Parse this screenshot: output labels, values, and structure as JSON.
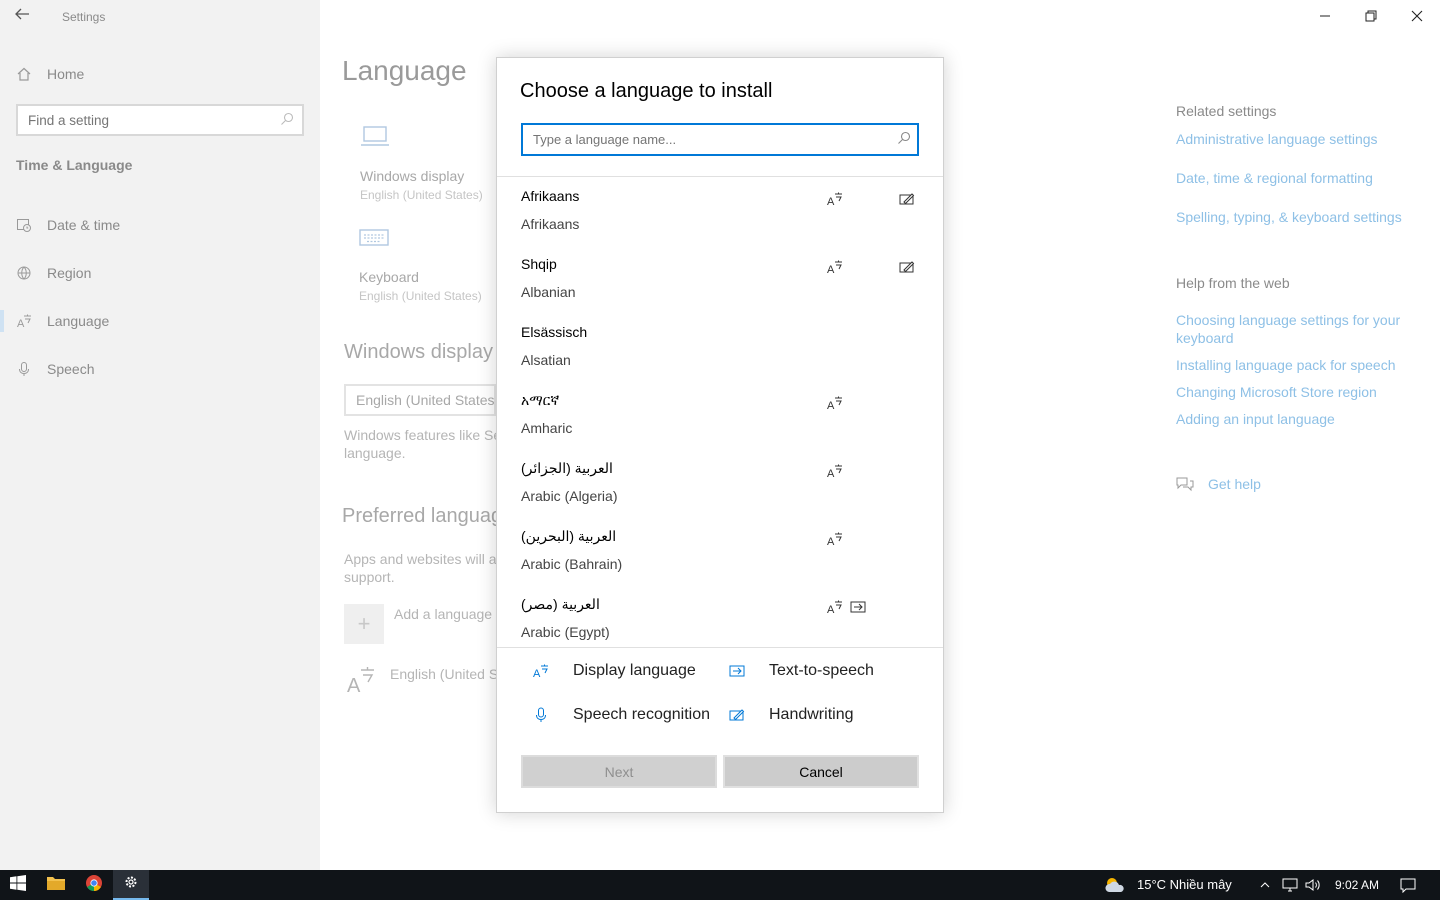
{
  "app": {
    "title": "Settings"
  },
  "sidebar": {
    "home_label": "Home",
    "search_placeholder": "Find a setting",
    "section": "Time & Language",
    "items": [
      {
        "label": "Date & time",
        "icon": "calendar-clock-icon"
      },
      {
        "label": "Region",
        "icon": "globe-icon"
      },
      {
        "label": "Language",
        "icon": "language-icon",
        "selected": true
      },
      {
        "label": "Speech",
        "icon": "microphone-icon"
      }
    ]
  },
  "main": {
    "title": "Language",
    "tiles": [
      {
        "label": "Windows display",
        "sub": "English (United States)",
        "icon": "laptop-icon"
      },
      {
        "label": "Keyboard",
        "sub": "English (United States)",
        "icon": "keyboard-icon"
      }
    ],
    "windows_display_heading": "Windows display",
    "display_dropdown_value": "English (United States)",
    "display_desc_line1": "Windows features like Se",
    "display_desc_line2": "language.",
    "preferred_heading": "Preferred languag",
    "preferred_desc_line1": "Apps and websites will ap",
    "preferred_desc_line2": "support.",
    "add_language_label": "Add a language",
    "english_row_label": "English (United St"
  },
  "related": {
    "heading": "Related settings",
    "links": [
      "Administrative language settings",
      "Date, time & regional formatting",
      "Spelling, typing, & keyboard settings"
    ]
  },
  "help": {
    "heading": "Help from the web",
    "links": [
      "Choosing language settings for your keyboard",
      "Installing language pack for speech",
      "Changing Microsoft Store region",
      "Adding an input language"
    ],
    "get_help": "Get help"
  },
  "dialog": {
    "title": "Choose a language to install",
    "search_placeholder": "Type a language name...",
    "languages": [
      {
        "native": "Afrikaans",
        "english": "Afrikaans",
        "display": true,
        "handwriting": true,
        "tts": false
      },
      {
        "native": "Shqip",
        "english": "Albanian",
        "display": true,
        "handwriting": true,
        "tts": false
      },
      {
        "native": "Elsässisch",
        "english": "Alsatian",
        "display": false,
        "handwriting": false,
        "tts": false
      },
      {
        "native": "አማርኛ",
        "english": "Amharic",
        "display": true,
        "handwriting": false,
        "tts": false
      },
      {
        "native": "العربية (الجزائر)",
        "english": "Arabic (Algeria)",
        "display": true,
        "handwriting": false,
        "tts": false
      },
      {
        "native": "العربية (البحرين)",
        "english": "Arabic (Bahrain)",
        "display": true,
        "handwriting": false,
        "tts": false
      },
      {
        "native": "العربية (مصر)",
        "english": "Arabic (Egypt)",
        "display": true,
        "handwriting": false,
        "tts": true
      }
    ],
    "legend": {
      "display": "Display language",
      "tts": "Text-to-speech",
      "speech": "Speech recognition",
      "handwriting": "Handwriting"
    },
    "next_label": "Next",
    "cancel_label": "Cancel"
  },
  "taskbar": {
    "weather": "15°C  Nhiều mây",
    "time": "9:02 AM"
  },
  "colors": {
    "accent": "#0078d7",
    "link": "#8ec0e6"
  }
}
